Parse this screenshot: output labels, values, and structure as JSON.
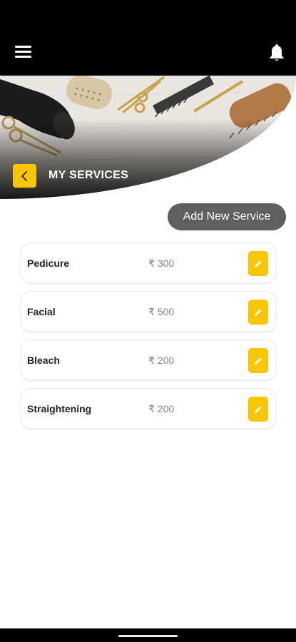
{
  "header": {
    "menu_icon": "hamburger-menu-icon",
    "notification_icon": "bell-icon"
  },
  "hero": {
    "title": "MY SERVICES",
    "back_icon": "chevron-left-icon",
    "image": "hair-styling-tools-photo"
  },
  "actions": {
    "add_label": "Add New Service"
  },
  "services": [
    {
      "name": "Pedicure",
      "price": "₹ 300"
    },
    {
      "name": "Facial",
      "price": "₹ 500"
    },
    {
      "name": "Bleach",
      "price": "₹ 200"
    },
    {
      "name": "Straightening",
      "price": "₹ 200"
    }
  ],
  "colors": {
    "accent": "#f9c600",
    "topbar": "#000000",
    "add_button": "#5f5f5f"
  },
  "edit_icon": "pencil-icon"
}
